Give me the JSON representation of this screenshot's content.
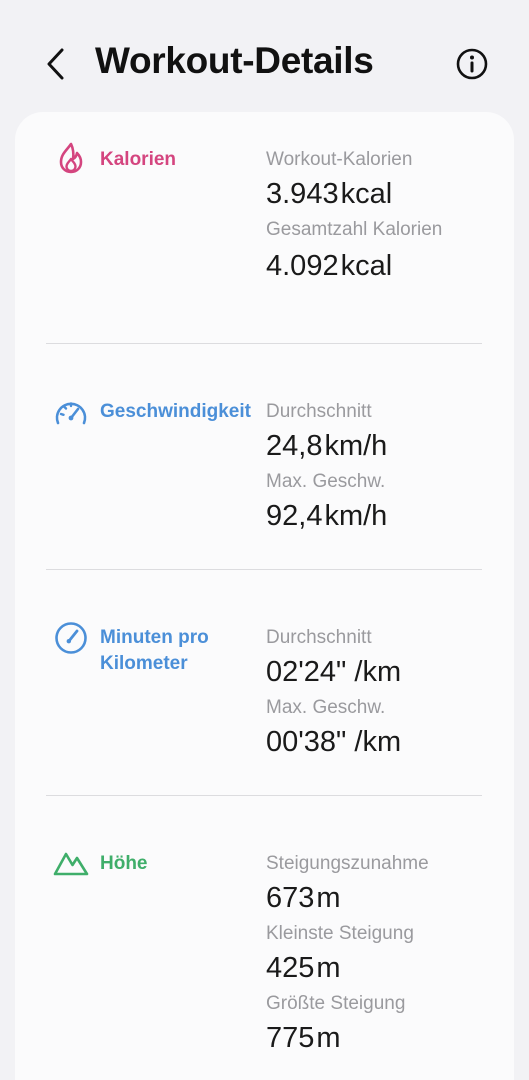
{
  "header": {
    "title": "Workout-Details",
    "back_icon": "chevron-left-icon",
    "info_icon": "info-icon"
  },
  "colors": {
    "calories": "#d4457f",
    "speed": "#4b8fd8",
    "pace": "#4b8fd8",
    "elevation": "#3fae6a"
  },
  "sections": {
    "calories": {
      "title": "Kalorien",
      "icon": "flame-icon",
      "workout_label": "Workout-Kalorien",
      "workout_value": "3.943",
      "workout_unit": "kcal",
      "total_label": "Gesamtzahl Kalorien",
      "total_value": "4.092",
      "total_unit": "kcal"
    },
    "speed": {
      "title": "Geschwindigkeit",
      "icon": "speedometer-icon",
      "avg_label": "Durchschnitt",
      "avg_value": "24,8",
      "avg_unit": "km/h",
      "max_label": "Max. Geschw.",
      "max_value": "92,4",
      "max_unit": "km/h"
    },
    "pace": {
      "title": "Minuten pro Kilometer",
      "icon": "gauge-icon",
      "avg_label": "Durchschnitt",
      "avg_value": "02'24\" /km",
      "max_label": "Max. Geschw.",
      "max_value": "00'38\" /km"
    },
    "elevation": {
      "title": "Höhe",
      "icon": "mountain-icon",
      "gain_label": "Steigungszunahme",
      "gain_value": "673",
      "gain_unit": "m",
      "min_label": "Kleinste Steigung",
      "min_value": "425",
      "min_unit": "m",
      "max_label": "Größte Steigung",
      "max_value": "775",
      "max_unit": "m"
    }
  }
}
